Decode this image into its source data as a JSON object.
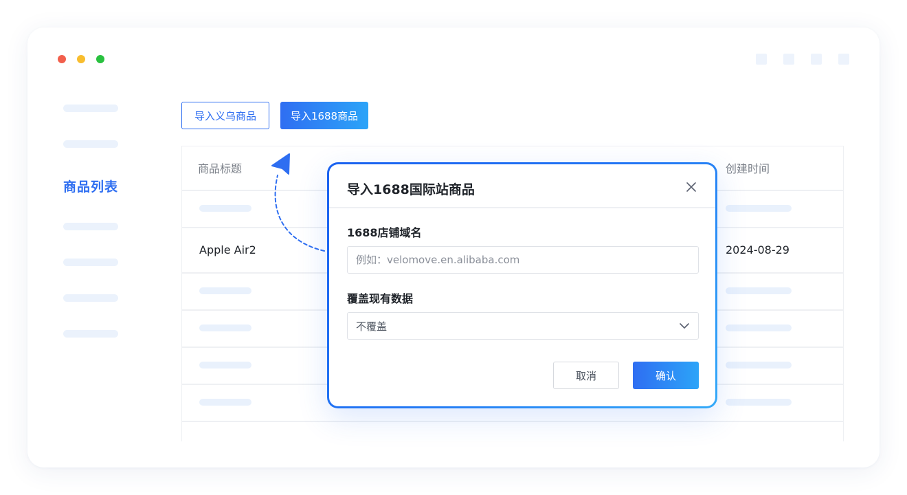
{
  "toolbar": {
    "import_yiwu_label": "导入义乌商品",
    "import_1688_label": "导入1688商品"
  },
  "sidebar": {
    "active_label": "商品列表"
  },
  "table": {
    "columns": [
      "商品标题",
      "创建时间"
    ],
    "rows": [
      {
        "title": "",
        "created": ""
      },
      {
        "title": "Apple Air2",
        "created": "2024-08-29"
      },
      {
        "title": "",
        "created": ""
      },
      {
        "title": "",
        "created": ""
      },
      {
        "title": "",
        "created": ""
      },
      {
        "title": "",
        "created": ""
      }
    ]
  },
  "modal": {
    "title": "导入1688国际站商品",
    "domain_label": "1688店铺域名",
    "domain_placeholder": "例如：velomove.en.alibaba.com",
    "overwrite_label": "覆盖现有数据",
    "overwrite_value": "不覆盖",
    "cancel_label": "取消",
    "confirm_label": "确认"
  },
  "colors": {
    "accent": "#2e6ef1",
    "accent_light": "#2ca4f8",
    "placeholder_bar": "#e9f1fc"
  }
}
